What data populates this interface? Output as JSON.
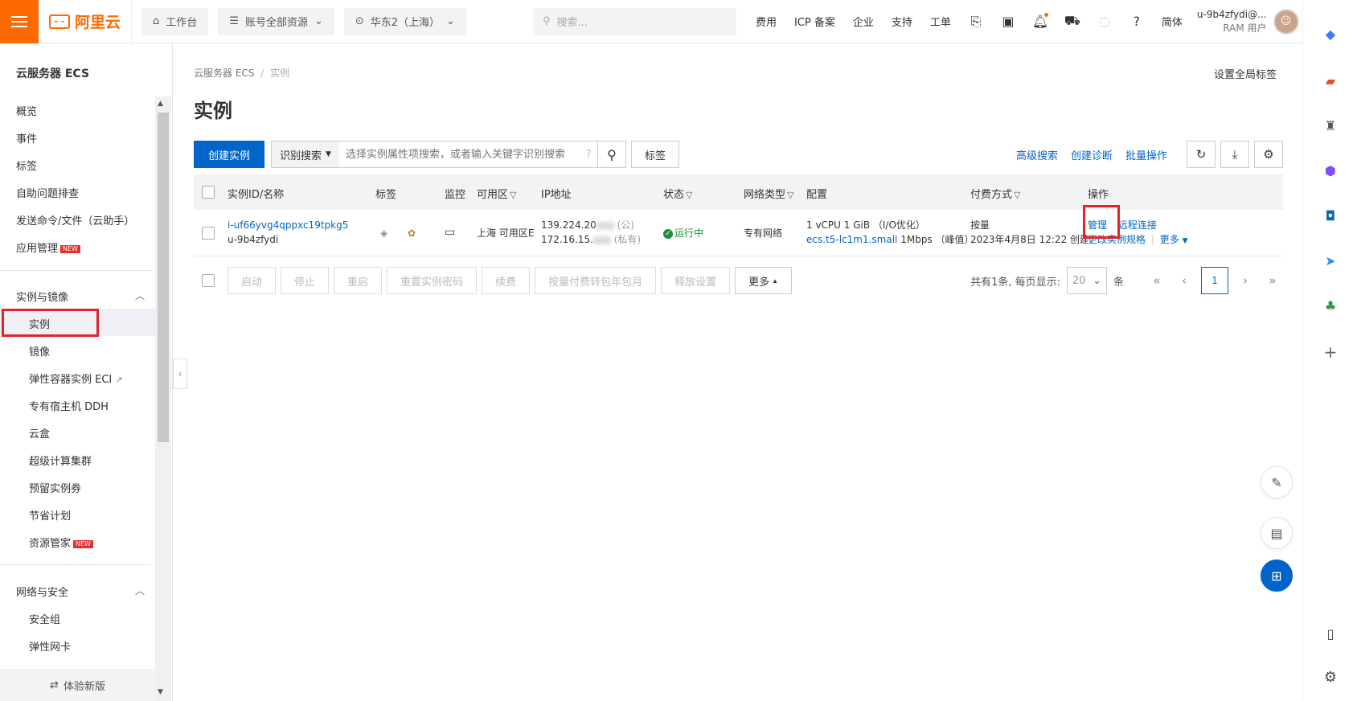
{
  "topbar": {
    "logo_text": "阿里云",
    "workbench": "工作台",
    "resources": "账号全部资源",
    "region": "华东2（上海）",
    "search_placeholder": "搜索...",
    "links": [
      "费用",
      "ICP 备案",
      "企业",
      "支持",
      "工单"
    ],
    "lang": "简体",
    "user_name": "u-9b4zfydi@...",
    "user_role": "RAM 用户"
  },
  "sidebar": {
    "title": "云服务器 ECS",
    "top_items": [
      "概览",
      "事件",
      "标签",
      "自助问题排查",
      "发送命令/文件（云助手）",
      "应用管理"
    ],
    "new_badge": "NEW",
    "group1": "实例与镜像",
    "group1_items": [
      "实例",
      "镜像",
      "弹性容器实例 ECI",
      "专有宿主机 DDH",
      "云盒",
      "超级计算集群",
      "预留实例券",
      "节省计划",
      "资源管家"
    ],
    "group2": "网络与安全",
    "group2_items": [
      "安全组",
      "弹性网卡"
    ],
    "footer": "体验新版"
  },
  "main": {
    "breadcrumb_root": "云服务器 ECS",
    "breadcrumb_current": "实例",
    "global_tag": "设置全局标签",
    "title": "实例",
    "create_button": "创建实例",
    "search_mode": "识别搜索",
    "search_placeholder": "选择实例属性项搜索，或者输入关键字识别搜索",
    "tag_button": "标签",
    "advanced_search": "高级搜索",
    "create_diagnosis": "创建诊断",
    "batch_ops": "批量操作"
  },
  "table": {
    "headers": [
      "实例ID/名称",
      "标签",
      "监控",
      "可用区",
      "IP地址",
      "状态",
      "网络类型",
      "配置",
      "付费方式",
      "操作"
    ],
    "row": {
      "instance_id": "i-uf66yvg4qppxc19tpkg5",
      "instance_name": "u-9b4zfydi",
      "zone": "上海 可用区E",
      "ip_public": "139.224.20",
      "ip_public_tag": "(公)",
      "ip_private": "172.16.15.",
      "ip_private_tag": "(私有)",
      "status": "运行中",
      "network": "专有网络",
      "config_line1": "1 vCPU 1 GiB （I/O优化）",
      "config_type": "ecs.t5-lc1m1.small",
      "config_bw": "1Mbps （峰值）",
      "billing": "按量",
      "created": "2023年4月8日 12:22 创建",
      "op_manage": "管理",
      "op_remote": "远程连接",
      "op_change": "更改实例规格",
      "op_more": "更多"
    }
  },
  "footer": {
    "buttons": [
      "启动",
      "停止",
      "重启",
      "重置实例密码",
      "续费",
      "按量付费转包年包月",
      "释放设置"
    ],
    "more": "更多",
    "total_text": "共有1条, 每页显示:",
    "page_size": "20",
    "unit": "条",
    "current_page": "1"
  },
  "colors": {
    "brand": "#ff6a00",
    "primary": "#0064c8",
    "highlight": "#e0242c"
  }
}
